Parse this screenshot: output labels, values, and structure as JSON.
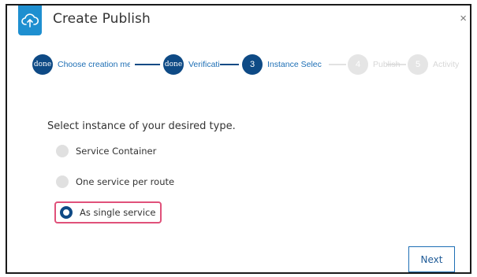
{
  "dialog": {
    "title": "Create Publish",
    "close_label": "×"
  },
  "stepper": {
    "steps": [
      {
        "marker": "done",
        "label": "Choose creation me",
        "state": "done"
      },
      {
        "marker": "done",
        "label": "Verificati",
        "state": "done"
      },
      {
        "marker": "3",
        "label": "Instance Selec",
        "state": "active"
      },
      {
        "marker": "4",
        "label": "Publish",
        "state": "pending"
      },
      {
        "marker": "5",
        "label": "Activity",
        "state": "pending"
      }
    ]
  },
  "instance_selection": {
    "question": "Select instance of your desired type.",
    "options": [
      {
        "label": "Service Container",
        "selected": false
      },
      {
        "label": "One service per route",
        "selected": false
      },
      {
        "label": "As single service",
        "selected": true
      }
    ]
  },
  "footer": {
    "next_label": "Next"
  },
  "colors": {
    "accent": "#0e4a85",
    "link": "#1e6fb5",
    "app_icon": "#1e8fd0",
    "highlight": "#e0517a",
    "pending": "#e5e5e5"
  },
  "icons": {
    "app": "cloud-upload-icon",
    "close": "close-icon"
  }
}
